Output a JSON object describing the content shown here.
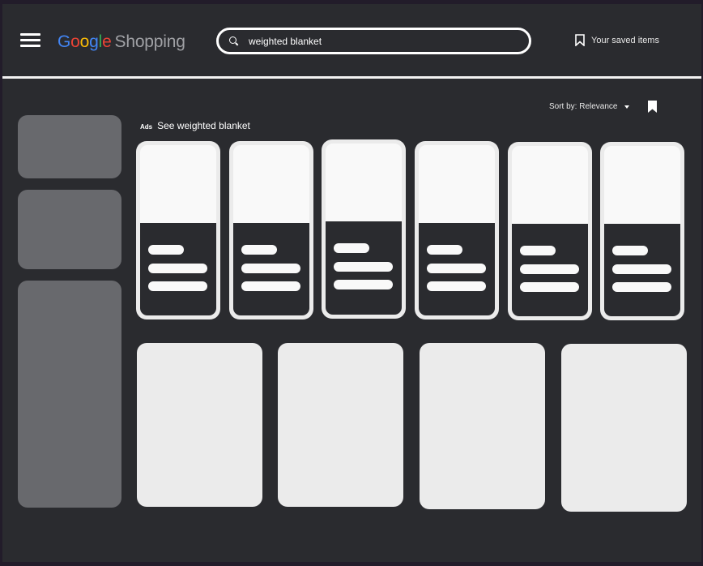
{
  "header": {
    "menu_icon": "hamburger-menu-icon",
    "logo": {
      "letters": [
        {
          "char": "G",
          "color": "#4285f4"
        },
        {
          "char": "o",
          "color": "#ea4335"
        },
        {
          "char": "o",
          "color": "#fbbc05"
        },
        {
          "char": "g",
          "color": "#4285f4"
        },
        {
          "char": "l",
          "color": "#34a853"
        },
        {
          "char": "e",
          "color": "#ea4335"
        }
      ],
      "product": "Shopping"
    },
    "search": {
      "icon": "search-icon",
      "value": "weighted blanket",
      "placeholder": ""
    },
    "saved_items": {
      "icon": "bookmark-outline-icon",
      "label": "Your saved items"
    }
  },
  "toolbar": {
    "sort_label": "Sort by: Relevance",
    "sort_icon": "caret-down-icon",
    "bookmark_icon": "bookmark-filled-icon"
  },
  "ads": {
    "tag": "Ads",
    "title": "See weighted blanket"
  },
  "sidebar": {
    "blocks": [
      "filter-1",
      "filter-2",
      "filter-3"
    ]
  },
  "product_cards": [
    {
      "id": 1
    },
    {
      "id": 2
    },
    {
      "id": 3
    },
    {
      "id": 4
    },
    {
      "id": 5
    },
    {
      "id": 6
    }
  ],
  "result_cards": [
    {
      "id": 1
    },
    {
      "id": 2
    },
    {
      "id": 3
    },
    {
      "id": 4
    }
  ],
  "colors": {
    "background": "#2a2b2f",
    "frame": "#221c2a",
    "sidebar_block": "#68696d",
    "card_border": "#ebebeb",
    "card_image": "#f9f9f9",
    "text": "#ffffff"
  }
}
